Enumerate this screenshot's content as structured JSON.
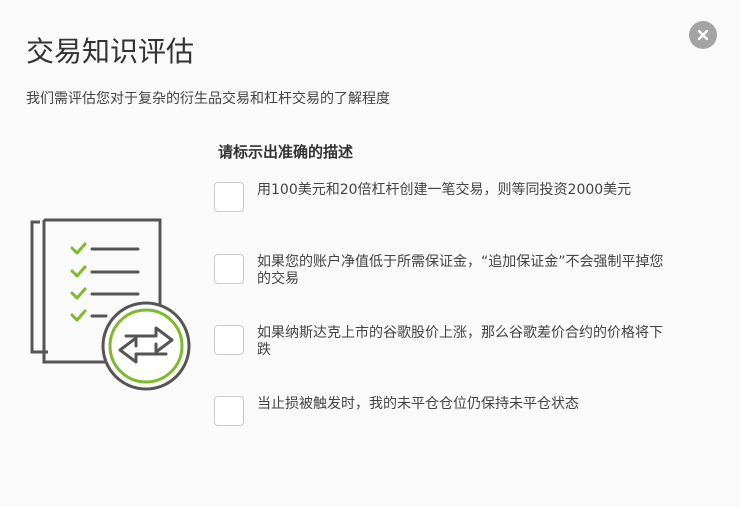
{
  "modal": {
    "title": "交易知识评估",
    "subtitle": "我们需评估您对于复杂的衍生品交易和杠杆交易的了解程度",
    "close_icon": "close-icon"
  },
  "question": {
    "prompt": "请标示出准确的描述",
    "options": [
      {
        "label": "用100美元和20倍杠杆创建一笔交易，则等同投资2000美元",
        "checked": false
      },
      {
        "label": "如果您的账户净值低于所需保证金，“追加保证金”不会强制平掉您的交易",
        "checked": false
      },
      {
        "label": "如果纳斯达克上市的谷歌股价上涨，那么谷歌差价合约的价格将下跌",
        "checked": false
      },
      {
        "label": "当止损被触发时，我的未平仓仓位仍保持未平仓状态",
        "checked": false
      }
    ]
  },
  "illustration": {
    "icon": "checklist-exchange-icon",
    "check_color": "#7dbb2a",
    "ring_color": "#7dbb2a",
    "line_color": "#555555"
  }
}
